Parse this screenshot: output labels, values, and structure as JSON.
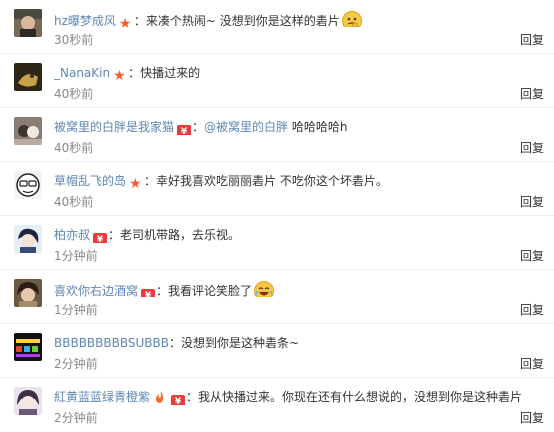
{
  "comments": [
    {
      "username": "hz曝梦成风",
      "badge": "star",
      "text": "来凑个热闹~ 没想到你是这样的砉片",
      "emoji": "thinking-emoji",
      "time": "30秒前",
      "reply": "回复"
    },
    {
      "username": "_NanaKin",
      "badge": "star",
      "text": "快播过来的",
      "time": "40秒前",
      "reply": "回复"
    },
    {
      "username": "被窝里的白胖是我家猫",
      "badge": "vip",
      "mention": "@被窝里的白胖",
      "text": " 哈哈哈哈h",
      "time": "40秒前",
      "reply": "回复"
    },
    {
      "username": "草帽乱飞的岛",
      "badge": "star",
      "text": "幸好我喜欢吃丽丽砉片 不吃你这个坏砉片。",
      "time": "40秒前",
      "reply": "回复"
    },
    {
      "username": "柏亦叔",
      "badge": "vip",
      "text": "老司机带路，去乐视。",
      "time": "1分钟前",
      "reply": "回复"
    },
    {
      "username": "喜欢你右边酒窝",
      "badge": "vip",
      "text": "我看评论笑脸了",
      "emoji": "laughing-emoji",
      "time": "1分钟前",
      "reply": "回复"
    },
    {
      "username": "BBBBBBBBBSUBBB",
      "text": "没想到你是这种砉条~",
      "time": "2分钟前",
      "reply": "回复"
    },
    {
      "username": "紅黄蓝蓝绿青橙紫",
      "badge": "vip",
      "text": "我从快播过来。你现在还有什么想说的，没想到你是这种砉片",
      "time": "2分钟前",
      "reply": "回复"
    }
  ],
  "colors": {
    "username": "#5f86b5",
    "time": "#888888",
    "text": "#333333",
    "badge_star": "#ff5a2a",
    "badge_vip": "#ef3a3a"
  }
}
